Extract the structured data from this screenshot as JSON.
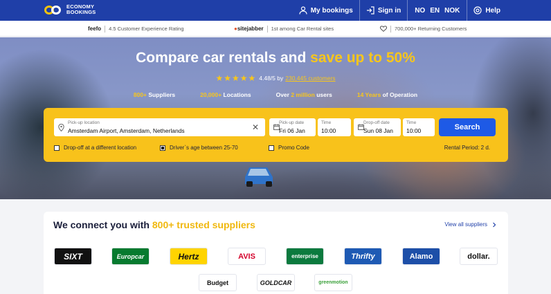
{
  "header": {
    "logo_line1": "ECONOMY",
    "logo_line2": "BOOKINGS",
    "my_bookings": "My bookings",
    "sign_in": "Sign in",
    "lang_no": "NO",
    "lang_en": "EN",
    "currency": "NOK",
    "help": "Help"
  },
  "trust": [
    {
      "brand": "feefo",
      "text": "4.5 Customer Experience Rating"
    },
    {
      "brand": "sitejabber",
      "text": "1st among Car Rental sites"
    },
    {
      "brand": "heart-icon",
      "text": "700,000+ Returning Customers"
    }
  ],
  "hero": {
    "title_main": "Compare car rentals and ",
    "title_highlight": "save up to 50%",
    "rating_value": "4.48/5 by",
    "rating_link": "230,445 customers",
    "stats": [
      {
        "num": "800+",
        "text": " Suppliers"
      },
      {
        "num": "20,000+",
        "text": " Locations"
      },
      {
        "prefix": "Over ",
        "num": "2 million",
        "text": " users"
      },
      {
        "num": "14 Years",
        "text": " of Operation"
      }
    ]
  },
  "search": {
    "pickup_location_label": "Pick-up location",
    "pickup_location_value": "Amsterdam Airport, Amsterdam, Netherlands",
    "pickup_date_label": "Pick-up date",
    "pickup_date_value": "Fri 06 Jan",
    "pickup_time_label": "Time",
    "pickup_time_value": "10:00",
    "dropoff_date_label": "Drop-off date",
    "dropoff_date_value": "Sun 08 Jan",
    "dropoff_time_label": "Time",
    "dropoff_time_value": "10:00",
    "button": "Search",
    "opt_dropoff": "Drop-off at a different location",
    "opt_age": "Driver`s age between 25-70",
    "opt_promo": "Promo Code",
    "rental_period": "Rental Period: 2 d."
  },
  "suppliers": {
    "title_main": "We connect you with ",
    "title_highlight": "800+ trusted suppliers",
    "view_all": "View all suppliers",
    "logos": [
      "SIXT",
      "Europcar",
      "Hertz",
      "AVIS",
      "enterprise",
      "Thrifty",
      "Alamo",
      "dollar.",
      "Budget",
      "GOLDCAR",
      "greenmotion"
    ]
  },
  "colors": {
    "brand_blue": "#1f3fa8",
    "accent_yellow": "#f8c21b",
    "search_blue": "#1e5ae6"
  }
}
